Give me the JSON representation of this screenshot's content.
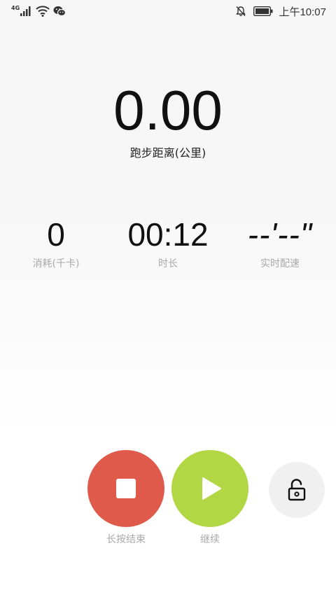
{
  "status_bar": {
    "network_label": "4G",
    "time": "上午10:07",
    "icons": [
      "signal-icon",
      "wifi-icon",
      "wechat-icon",
      "mute-bell-icon",
      "battery-icon"
    ]
  },
  "distance": {
    "value": "0.00",
    "label": "跑步距离(公里)"
  },
  "stats": {
    "calories": {
      "value": "0",
      "label": "消耗(千卡)"
    },
    "duration": {
      "value": "00:12",
      "label": "时长"
    },
    "pace": {
      "value": "--'--\"",
      "label": "实时配速"
    }
  },
  "controls": {
    "stop_label": "长按结束",
    "resume_label": "继续",
    "icons": [
      "stop-icon",
      "play-icon",
      "unlock-icon"
    ]
  },
  "colors": {
    "stop": "#e05a4b",
    "resume": "#b2d744",
    "lock_bg": "#f0f0f0",
    "label_gray": "#a9a9a9"
  }
}
